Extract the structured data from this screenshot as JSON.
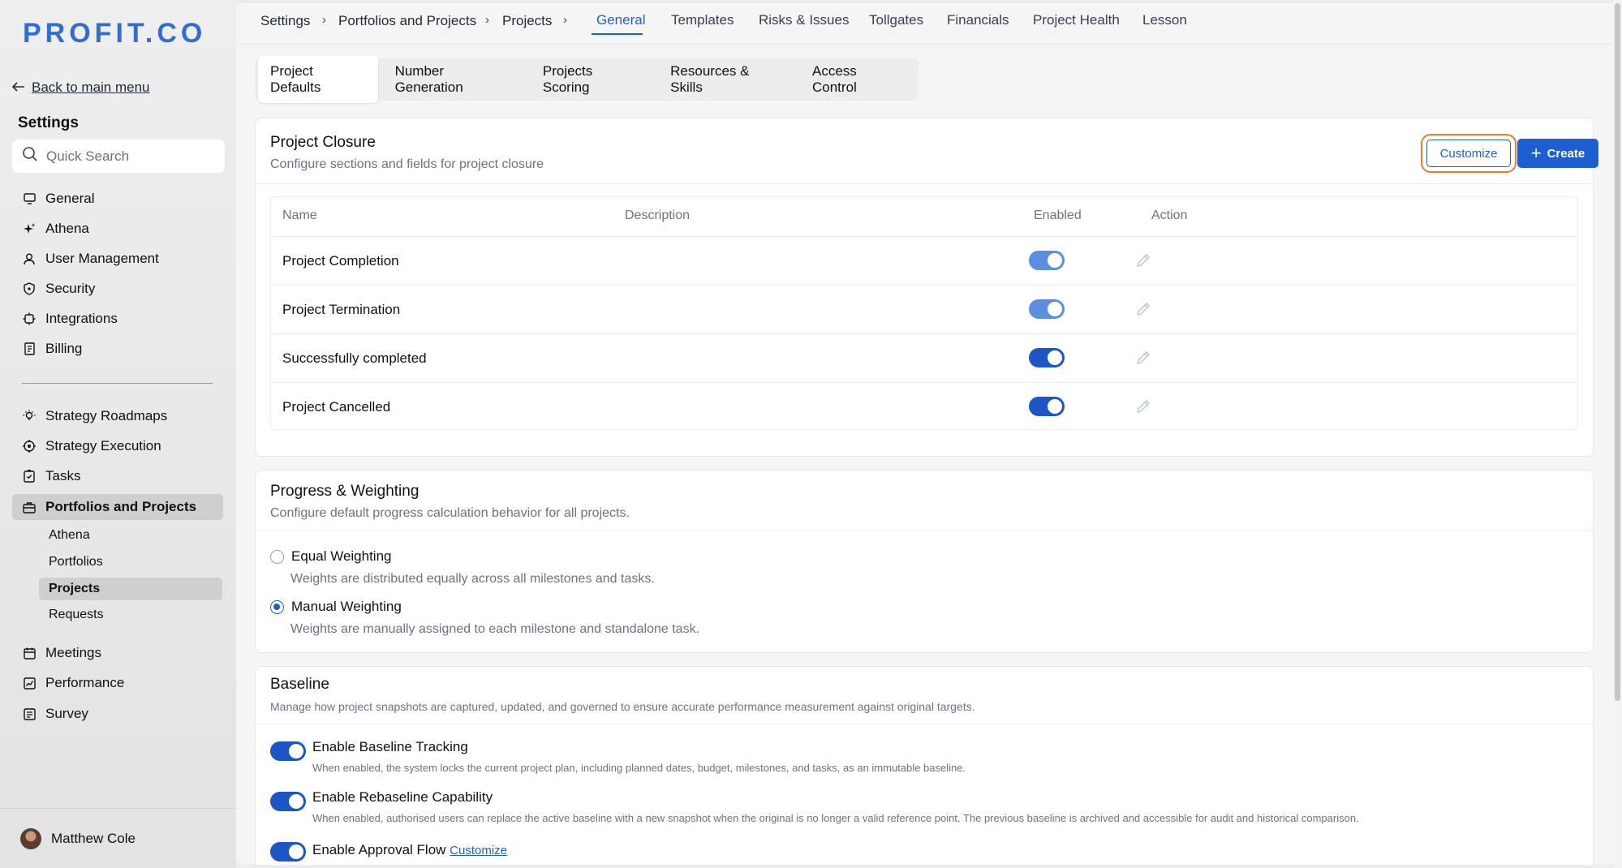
{
  "brand": {
    "logo": "PROFIT.CO"
  },
  "sidebar": {
    "back_link": "Back to main menu",
    "title": "Settings",
    "search_placeholder": "Quick Search",
    "items_top": [
      {
        "label": "General",
        "icon": "monitor-icon"
      },
      {
        "label": "Athena",
        "icon": "sparkle-icon"
      },
      {
        "label": "User Management",
        "icon": "user-icon"
      },
      {
        "label": "Security",
        "icon": "shield-icon"
      },
      {
        "label": "Integrations",
        "icon": "puzzle-icon"
      },
      {
        "label": "Billing",
        "icon": "receipt-icon"
      }
    ],
    "items_bottom": [
      {
        "label": "Strategy Roadmaps",
        "icon": "bulb-icon"
      },
      {
        "label": "Strategy Execution",
        "icon": "target-icon"
      },
      {
        "label": "Tasks",
        "icon": "clipboard-check-icon"
      },
      {
        "label": "Portfolios and Projects",
        "icon": "briefcase-icon"
      }
    ],
    "sub_items": [
      "Athena",
      "Portfolios",
      "Projects",
      "Requests"
    ],
    "items_after": [
      {
        "label": "Meetings",
        "icon": "calendar-icon"
      },
      {
        "label": "Performance",
        "icon": "chart-icon"
      },
      {
        "label": "Survey",
        "icon": "survey-icon"
      }
    ],
    "user_name": "Matthew Cole"
  },
  "topbar": {
    "breadcrumb": [
      "Settings",
      "Portfolios and Projects",
      "Projects"
    ],
    "separator": "›",
    "tabs": [
      "General",
      "Templates",
      "Risks & Issues",
      "Tollgates",
      "Financials",
      "Project Health",
      "Lesson"
    ],
    "active_tab": "General"
  },
  "subtabs": [
    "Project Defaults",
    "Number Generation",
    "Projects Scoring",
    "Resources & Skills",
    "Access Control"
  ],
  "closure": {
    "title": "Project Closure",
    "subtitle": "Configure sections and fields for project closure",
    "customize_label": "Customize",
    "create_label": "Create",
    "columns": [
      "Name",
      "Description",
      "Enabled",
      "Action"
    ],
    "rows": [
      {
        "name": "Project Completion",
        "enabled": true
      },
      {
        "name": "Project Termination",
        "enabled": true
      },
      {
        "name": "Successfully completed",
        "enabled": true
      },
      {
        "name": "Project Cancelled",
        "enabled": true
      }
    ]
  },
  "progress": {
    "title": "Progress & Weighting",
    "subtitle": "Configure default progress calculation behavior for all projects.",
    "options": [
      {
        "label": "Equal Weighting",
        "desc": "Weights are distributed equally across all milestones and tasks.",
        "checked": false
      },
      {
        "label": "Manual Weighting",
        "desc": "Weights are manually assigned to each milestone and standalone task.",
        "checked": true
      }
    ]
  },
  "baseline": {
    "title": "Baseline",
    "subtitle": "Manage how project snapshots are captured, updated, and governed to ensure accurate performance measurement against original targets.",
    "settings": [
      {
        "label": "Enable Baseline Tracking",
        "desc": "When enabled, the system locks the current project plan, including planned dates, budget, milestones, and tasks, as an immutable baseline.",
        "enabled": true
      },
      {
        "label": "Enable Rebaseline Capability",
        "desc": "When enabled, authorised users can replace the active baseline with a new snapshot when the original is no longer a valid reference point. The previous baseline is archived and accessible for audit and historical comparison.",
        "enabled": true
      },
      {
        "label": "Enable Approval Flow",
        "link": "Customize",
        "enabled": true
      }
    ]
  },
  "colors": {
    "accent": "#1d5fd1",
    "highlight": "#f07b22",
    "toggle_on": "#1c56c4",
    "toggle_dim": "#5b8de0"
  }
}
